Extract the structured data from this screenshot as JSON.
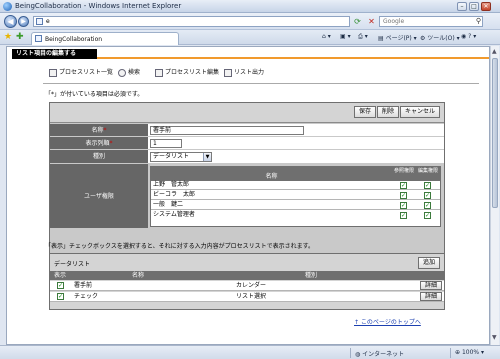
{
  "browser": {
    "title": "BeingCollaboration - Windows Internet Explorer",
    "address": "e",
    "search_placeholder": "Google",
    "tab_label": "BeingCollaboration",
    "tools": {
      "page_label": "ページ(P)",
      "tools_label": "ツール(O)",
      "help_label": "?"
    },
    "status": {
      "zone": "インターネット",
      "zoom": "100%"
    }
  },
  "page": {
    "header_label": "リスト項目の編集する",
    "toolbar": [
      {
        "label": "プロセスリスト一覧",
        "icon": "list-icon"
      },
      {
        "label": "検索",
        "icon": "search-icon"
      },
      {
        "label": "プロセスリスト編集",
        "icon": "edit-list-icon"
      },
      {
        "label": "リスト出力",
        "icon": "export-icon"
      }
    ],
    "required_note": "「*」が付いている項目は必須です。",
    "buttons": {
      "save": "保存",
      "delete": "削除",
      "cancel": "キャンセル"
    },
    "form": {
      "name_label": "名称",
      "name_value": "署手前",
      "order_label": "表示列順",
      "order_value": "1",
      "type_label": "種別",
      "type_value": "データリスト",
      "perm_label": "ユーザ権限",
      "required_mark": "*"
    },
    "perm_table": {
      "col_name": "名称",
      "col_ref": "参照権限",
      "col_edit": "編集権限",
      "rows": [
        {
          "name": "上野　管太郎",
          "ref": true,
          "edit": true
        },
        {
          "name": "ビーコラ　太郎",
          "ref": true,
          "edit": true
        },
        {
          "name": "一般　鍵二",
          "ref": true,
          "edit": true
        },
        {
          "name": "システム管理者",
          "ref": true,
          "edit": true
        }
      ]
    },
    "display_note": "「表示」チェックボックスを選択すると、それに対する入力内容がプロセスリストで表示されます。",
    "datalist": {
      "title": "データリスト",
      "add_label": "追加",
      "col_show": "表示",
      "col_name": "名称",
      "col_type": "種別",
      "rows": [
        {
          "show": true,
          "name": "署手前",
          "type": "カレンダー",
          "detail": "詳細"
        },
        {
          "show": true,
          "name": "チェック",
          "type": "リスト選択",
          "detail": "詳細"
        }
      ]
    },
    "top_link": "↑ このページのトップへ"
  }
}
